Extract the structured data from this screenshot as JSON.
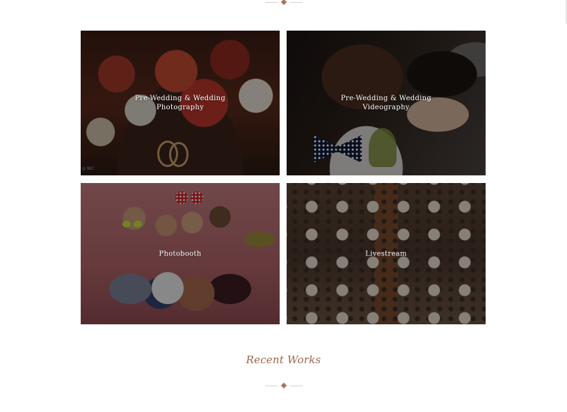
{
  "services": [
    {
      "label": "Pre-Wedding & Wedding\nPhotography"
    },
    {
      "label": "Pre-Wedding & Wedding\nVideography"
    },
    {
      "label": "Photobooth"
    },
    {
      "label": "Livestream"
    }
  ],
  "recent_works": {
    "title": "Recent Works"
  },
  "colors": {
    "accent": "#a06548",
    "divider_line": "#d8cfc8",
    "divider_diamond": "#b0735a",
    "overlay": "rgba(0,0,0,0.42)",
    "tile_text": "#ffffff"
  }
}
